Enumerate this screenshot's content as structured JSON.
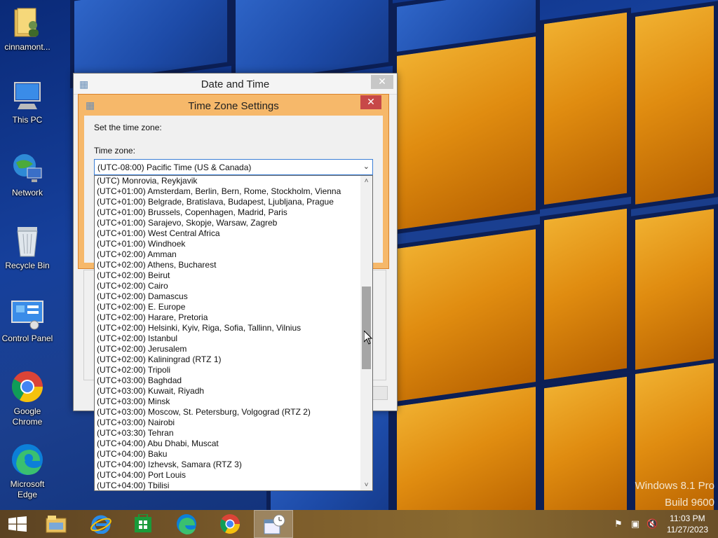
{
  "desktop": {
    "icons": [
      {
        "label": "cinnamont...",
        "icon": "user-folder-icon"
      },
      {
        "label": "This PC",
        "icon": "computer-icon"
      },
      {
        "label": "Network",
        "icon": "network-icon"
      },
      {
        "label": "Recycle Bin",
        "icon": "recycle-bin-icon"
      },
      {
        "label": "Control Panel",
        "icon": "control-panel-icon"
      },
      {
        "label": "Google Chrome",
        "icon": "chrome-icon"
      },
      {
        "label": "Microsoft Edge",
        "icon": "edge-icon"
      }
    ],
    "watermark": {
      "line1": "Windows 8.1 Pro",
      "line2": "Build 9600"
    }
  },
  "date_time_window": {
    "title": "Date and Time",
    "close": "✕"
  },
  "timezone_dialog": {
    "title": "Time Zone Settings",
    "close": "✕",
    "set_label": "Set the time zone:",
    "tz_label": "Time zone:",
    "selected": "(UTC-08:00) Pacific Time (US & Canada)"
  },
  "timezone_list": [
    "(UTC) Monrovia, Reykjavik",
    "(UTC+01:00) Amsterdam, Berlin, Bern, Rome, Stockholm, Vienna",
    "(UTC+01:00) Belgrade, Bratislava, Budapest, Ljubljana, Prague",
    "(UTC+01:00) Brussels, Copenhagen, Madrid, Paris",
    "(UTC+01:00) Sarajevo, Skopje, Warsaw, Zagreb",
    "(UTC+01:00) West Central Africa",
    "(UTC+01:00) Windhoek",
    "(UTC+02:00) Amman",
    "(UTC+02:00) Athens, Bucharest",
    "(UTC+02:00) Beirut",
    "(UTC+02:00) Cairo",
    "(UTC+02:00) Damascus",
    "(UTC+02:00) E. Europe",
    "(UTC+02:00) Harare, Pretoria",
    "(UTC+02:00) Helsinki, Kyiv, Riga, Sofia, Tallinn, Vilnius",
    "(UTC+02:00) Istanbul",
    "(UTC+02:00) Jerusalem",
    "(UTC+02:00) Kaliningrad (RTZ 1)",
    "(UTC+02:00) Tripoli",
    "(UTC+03:00) Baghdad",
    "(UTC+03:00) Kuwait, Riyadh",
    "(UTC+03:00) Minsk",
    "(UTC+03:00) Moscow, St. Petersburg, Volgograd (RTZ 2)",
    "(UTC+03:00) Nairobi",
    "(UTC+03:30) Tehran",
    "(UTC+04:00) Abu Dhabi, Muscat",
    "(UTC+04:00) Baku",
    "(UTC+04:00) Izhevsk, Samara (RTZ 3)",
    "(UTC+04:00) Port Louis",
    "(UTC+04:00) Tbilisi"
  ],
  "taskbar": {
    "apps": [
      "start-icon",
      "file-explorer-icon",
      "internet-explorer-icon",
      "store-icon",
      "edge-icon",
      "chrome-icon",
      "date-time-icon"
    ],
    "tray": [
      "flag-icon",
      "network-tray-icon",
      "volume-muted-icon"
    ],
    "time": "11:03 PM",
    "date": "11/27/2023"
  }
}
